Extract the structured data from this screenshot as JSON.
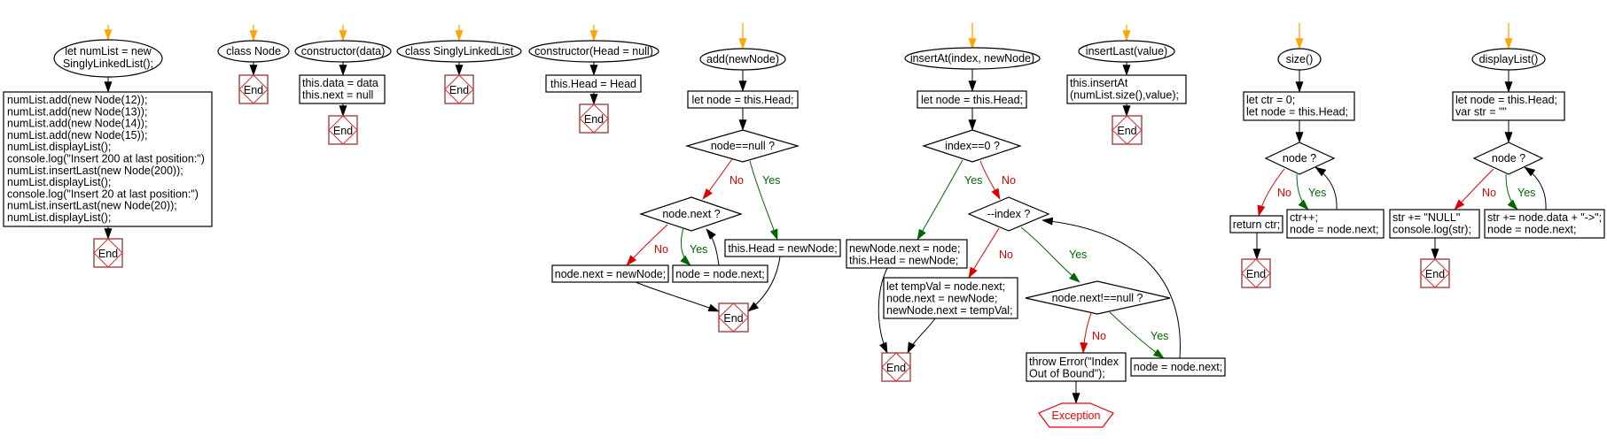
{
  "labels": {
    "end": "End",
    "yes": "Yes",
    "no": "No"
  },
  "colors": {
    "start_arrow": "#ffa500",
    "no_branch": "#dd0000",
    "yes_branch": "#006600",
    "end_border": "#993333",
    "exception": "#ee0000"
  },
  "flows": {
    "main": {
      "start": [
        "let numList = new",
        "SinglyLinkedList();"
      ],
      "code": [
        "numList.add(new Node(12));",
        "numList.add(new Node(13));",
        "numList.add(new Node(14));",
        "numList.add(new Node(15));",
        "numList.displayList();",
        "console.log(\"Insert 200 at last position:\")",
        "numList.insertLast(new Node(200));",
        "numList.displayList();",
        "console.log(\"Insert 20 at last position:\")",
        "numList.insertLast(new Node(20));",
        "numList.displayList();"
      ]
    },
    "node_class": {
      "start": "class Node"
    },
    "node_ctor": {
      "start": "constructor(data)",
      "code": [
        "this.data = data",
        "this.next = null"
      ]
    },
    "sll_class": {
      "start": "class SinglyLinkedList"
    },
    "sll_ctor": {
      "start": "constructor(Head = null)",
      "code": [
        "this.Head = Head"
      ]
    },
    "add": {
      "start": "add(newNode)",
      "init": "let node = this.Head;",
      "cond1": "node==null ?",
      "cond2": "node.next ?",
      "set_next": "node.next = newNode;",
      "advance": "node = node.next;",
      "set_head": "this.Head = newNode;"
    },
    "insert_at": {
      "start": "insertAt(index, newNode)",
      "init": "let node = this.Head;",
      "cond1": "index==0 ?",
      "head_insert": [
        "newNode.next = node;",
        "this.Head = newNode;"
      ],
      "cond2": "--index ?",
      "mid_insert": [
        "let tempVal = node.next;",
        "node.next = newNode;",
        "newNode.next = tempVal;"
      ],
      "cond3": "node.next!==null ?",
      "throw": [
        "throw Error(\"Index",
        "Out of Bound\");"
      ],
      "advance": "node = node.next;",
      "exception": "Exception"
    },
    "insert_last": {
      "start": "insertLast(value)",
      "code": [
        "this.insertAt",
        "(numList.size(),value);"
      ]
    },
    "size": {
      "start": "size()",
      "init": [
        "let ctr = 0;",
        "let node = this.Head;"
      ],
      "cond": "node ?",
      "ret": "return ctr;",
      "loop": [
        "ctr++;",
        "node = node.next;"
      ]
    },
    "display": {
      "start": "displayList()",
      "init": [
        "let node = this.Head;",
        "var str = \"\""
      ],
      "cond": "node ?",
      "done": [
        "str += \"NULL\"",
        "console.log(str);"
      ],
      "loop": [
        "str += node.data + \"->\";",
        "node = node.next;"
      ]
    }
  }
}
